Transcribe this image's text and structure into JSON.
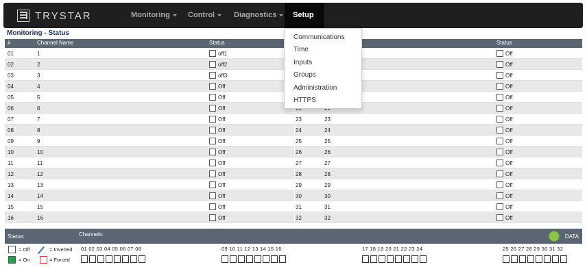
{
  "brand": "TRYSTAR",
  "nav": [
    {
      "label": "Monitoring"
    },
    {
      "label": "Control"
    },
    {
      "label": "Diagnostics"
    },
    {
      "label": "Setup"
    }
  ],
  "page_title": "Monitoring - Status",
  "table": {
    "headers": {
      "num": "#",
      "channel_name": "Channel Name",
      "status": "Status",
      "status2": "Status"
    },
    "left_rows": [
      {
        "num": "01",
        "name": "1",
        "status": "off1"
      },
      {
        "num": "02",
        "name": "2",
        "status": "off2"
      },
      {
        "num": "03",
        "name": "3",
        "status": "off3"
      },
      {
        "num": "04",
        "name": "4",
        "status": "Off"
      },
      {
        "num": "05",
        "name": "5",
        "status": "Off"
      },
      {
        "num": "06",
        "name": "6",
        "status": "Off"
      },
      {
        "num": "07",
        "name": "7",
        "status": "Off"
      },
      {
        "num": "08",
        "name": "8",
        "status": "Off"
      },
      {
        "num": "09",
        "name": "9",
        "status": "Off"
      },
      {
        "num": "10",
        "name": "10",
        "status": "Off"
      },
      {
        "num": "11",
        "name": "11",
        "status": "Off"
      },
      {
        "num": "12",
        "name": "12",
        "status": "Off"
      },
      {
        "num": "13",
        "name": "13",
        "status": "Off"
      },
      {
        "num": "14",
        "name": "14",
        "status": "Off"
      },
      {
        "num": "15",
        "name": "15",
        "status": "Off"
      },
      {
        "num": "16",
        "name": "16",
        "status": "Off"
      }
    ],
    "right_rows": [
      {
        "num": "",
        "name": "",
        "status": "Off"
      },
      {
        "num": "",
        "name": "",
        "status": "Off"
      },
      {
        "num": "",
        "name": "",
        "status": "Off"
      },
      {
        "num": "",
        "name": "",
        "status": "Off"
      },
      {
        "num": "",
        "name": "",
        "status": "Off"
      },
      {
        "num": "22",
        "name": "22",
        "status": "Off"
      },
      {
        "num": "23",
        "name": "23",
        "status": "Off"
      },
      {
        "num": "24",
        "name": "24",
        "status": "Off"
      },
      {
        "num": "25",
        "name": "25",
        "status": "Off"
      },
      {
        "num": "26",
        "name": "26",
        "status": "Off"
      },
      {
        "num": "27",
        "name": "27",
        "status": "Off"
      },
      {
        "num": "28",
        "name": "28",
        "status": "Off"
      },
      {
        "num": "29",
        "name": "29",
        "status": "Off"
      },
      {
        "num": "30",
        "name": "30",
        "status": "Off"
      },
      {
        "num": "31",
        "name": "31",
        "status": "Off"
      },
      {
        "num": "32",
        "name": "32",
        "status": "Off"
      }
    ]
  },
  "statusbar": {
    "status_label": "Status:",
    "channels_label": "Channels:",
    "data_label": "DATA",
    "led_color": "#8bc34a"
  },
  "legend": {
    "off": "= Off",
    "on": "= On",
    "inverted": "= Inverted",
    "forced": "= Forced",
    "on_color": "#1aa34a",
    "forced_color": "#e53935",
    "inverted_color": "#2a6fd4"
  },
  "channel_groups": [
    "01 02 03 04 05 06 07 08",
    "09 10 11 12 13 14 15 16",
    "17 18 19 20 21 22 23 24",
    "25 26 27 28 29 30 31 32"
  ],
  "setup_menu": [
    "Communications",
    "Time",
    "Inputs",
    "Groups",
    "Administration",
    "HTTPS"
  ]
}
